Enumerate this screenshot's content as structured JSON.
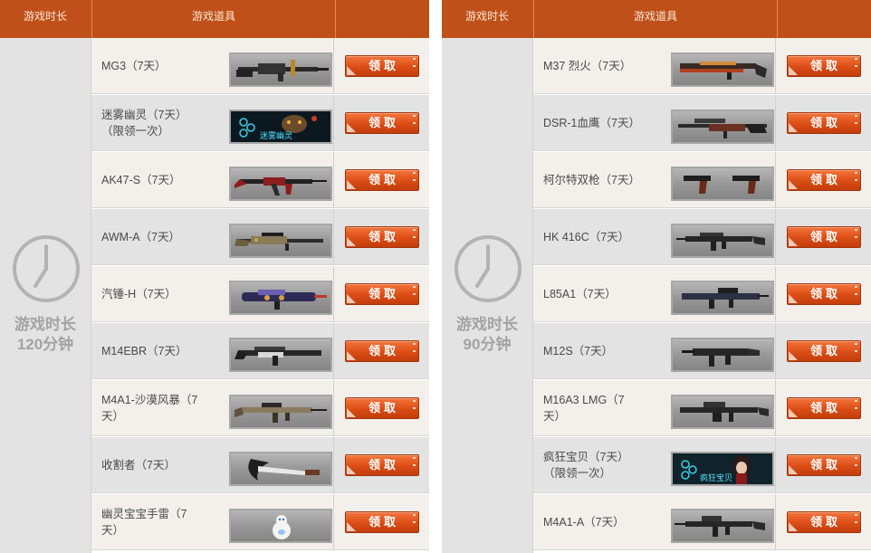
{
  "header": {
    "col_duration": "游戏时长",
    "col_items": "游戏道具",
    "col_action": ""
  },
  "claim_label": "领取",
  "panels": [
    {
      "duration_line1": "游戏时长",
      "duration_line2": "120分钟",
      "icon": "clock-icon",
      "items": [
        {
          "name": "MG3（7天）",
          "icon": "mg3-machine-gun-image"
        },
        {
          "name": "迷雾幽灵（7天）（限领一次）",
          "icon": "mist-ghost-character-image",
          "thumb_text": "迷雾幽灵"
        },
        {
          "name": "AK47-S（7天）",
          "icon": "ak47-rifle-image"
        },
        {
          "name": "AWM-A（7天）",
          "icon": "awm-sniper-image"
        },
        {
          "name": "汽锤-H（7天）",
          "icon": "steam-hammer-gun-image"
        },
        {
          "name": "M14EBR（7天）",
          "icon": "m14ebr-rifle-image"
        },
        {
          "name": "M4A1-沙漠风暴（7天）",
          "icon": "m4a1-desert-rifle-image"
        },
        {
          "name": "收割者（7天）",
          "icon": "reaper-blade-image"
        },
        {
          "name": "幽灵宝宝手雷（7天）",
          "icon": "ghost-baby-grenade-image"
        }
      ]
    },
    {
      "duration_line1": "游戏时长",
      "duration_line2": "90分钟",
      "icon": "clock-icon",
      "items": [
        {
          "name": "M37 烈火（7天）",
          "icon": "m37-shotgun-image"
        },
        {
          "name": "DSR-1血鹰（7天）",
          "icon": "dsr1-sniper-image"
        },
        {
          "name": "柯尔特双枪（7天）",
          "icon": "colt-dual-pistols-image"
        },
        {
          "name": "HK 416C（7天）",
          "icon": "hk416c-rifle-image"
        },
        {
          "name": "L85A1（7天）",
          "icon": "l85a1-rifle-image"
        },
        {
          "name": "M12S（7天）",
          "icon": "m12s-smg-image"
        },
        {
          "name": "M16A3 LMG（7天）",
          "icon": "m16a3-lmg-image"
        },
        {
          "name": "疯狂宝贝（7天）（限领一次）",
          "icon": "crazy-baby-character-image",
          "thumb_text": "疯狂宝贝"
        },
        {
          "name": "M4A1-A（7天）",
          "icon": "m4a1-a-rifle-image"
        }
      ]
    }
  ],
  "colors": {
    "header_bg": "#c0501a",
    "button_bg": "#db4d16",
    "row_light": "#f3f0ec",
    "row_dark": "#e3e3e3"
  }
}
